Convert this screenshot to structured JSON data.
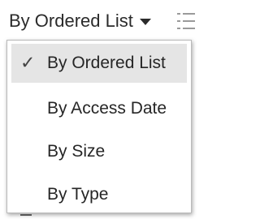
{
  "sort_control": {
    "current_label": "By Ordered List"
  },
  "icons": {
    "dropdown_caret": "caret-down-icon",
    "view_toggle": "list-view-icon",
    "selected_mark": "check-icon"
  },
  "menu": {
    "items": [
      {
        "label": "By Ordered List",
        "selected": true,
        "check": "✓"
      },
      {
        "label": "By Access Date",
        "selected": false,
        "check": ""
      },
      {
        "label": "By Size",
        "selected": false,
        "check": ""
      },
      {
        "label": "By Type",
        "selected": false,
        "check": ""
      }
    ]
  },
  "colors": {
    "selected_background": "#e5e5e5",
    "menu_border": "#b9b9b9",
    "text": "#262626"
  }
}
